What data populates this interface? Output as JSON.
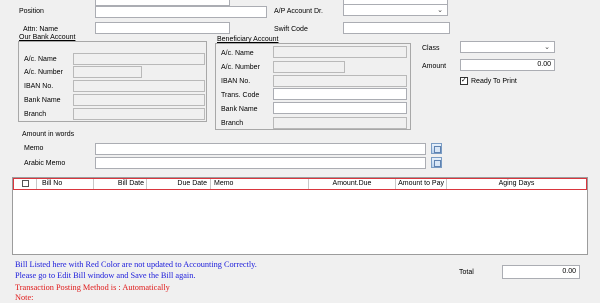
{
  "form": {
    "position_label": "Position",
    "ap_account_label": "A/P Account Dr.",
    "attn_name_label": "Attn: Name",
    "swift_code_label": "Swift Code",
    "our_bank_title": "Our Bank Account",
    "beneficiary_title": "Beneficiary Account",
    "our_bank": {
      "ac_name_label": "A/c. Name",
      "ac_number_label": "A/c. Number",
      "iban_label": "IBAN No.",
      "bank_name_label": "Bank Name",
      "branch_label": "Branch"
    },
    "beneficiary": {
      "ac_name_label": "A/c. Name",
      "ac_number_label": "A/c. Number",
      "iban_label": "IBAN No.",
      "trans_code_label": "Trans. Code",
      "bank_name_label": "Bank Name",
      "branch_label": "Branch"
    },
    "class_label": "Class",
    "amount_label": "Amount",
    "amount_value": "0.00",
    "ready_to_print_label": "Ready To Print",
    "ready_to_print_checked": true,
    "amount_in_words_label": "Amount in words",
    "memo_label": "Memo",
    "arabic_memo_label": "Arabic Memo"
  },
  "grid": {
    "columns": [
      "Bill No",
      "Bill Date",
      "Due Date",
      "Memo",
      "Amount.Due",
      "Amount to Pay",
      "Aging Days"
    ]
  },
  "notes": {
    "line1": "Bill Listed here with Red Color are not updated to Accounting Correctly.",
    "line2": "Please go to Edit Bill window and Save the Bill again.",
    "line3": "Transaction Posting Method is : Automatically",
    "line4": "Note:"
  },
  "footer": {
    "total_label": "Total",
    "total_value": "0.00"
  },
  "colors": {
    "note_blue": "#1a1adb",
    "note_red": "#e01b1b",
    "grid_header_border": "#d9363e"
  }
}
